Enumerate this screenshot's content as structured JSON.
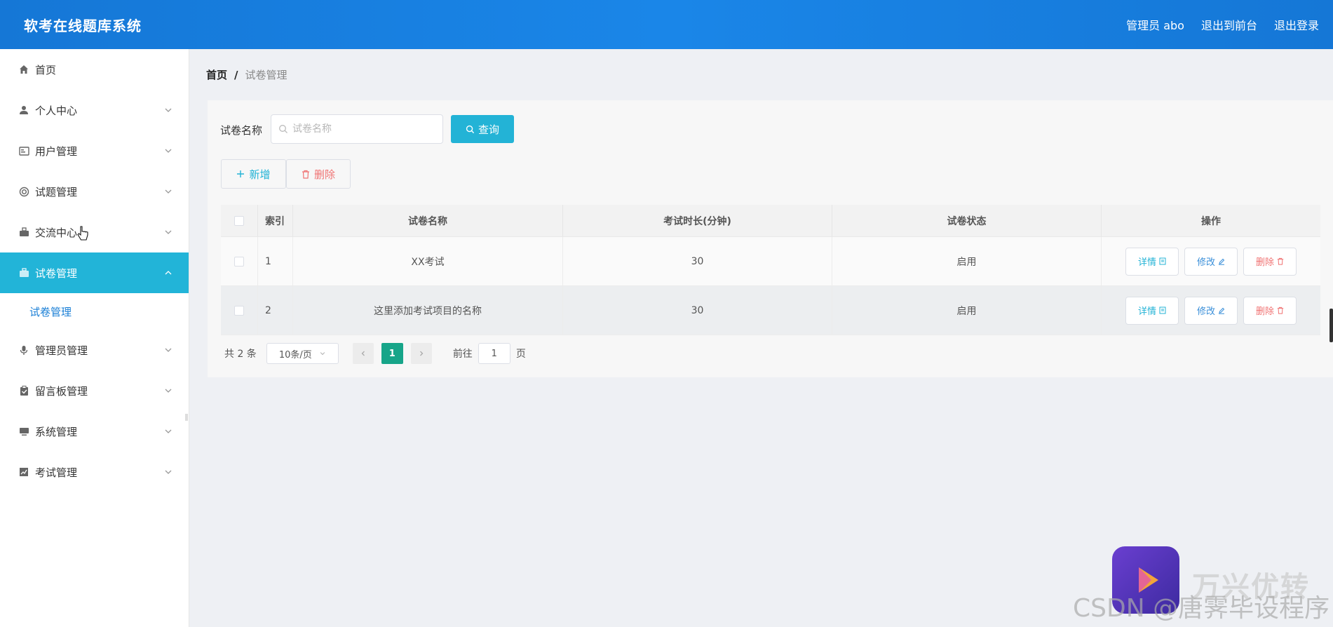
{
  "header": {
    "title": "软考在线题库系统",
    "admin": "管理员 abo",
    "front": "退出到前台",
    "logout": "退出登录"
  },
  "sidebar": {
    "items": [
      {
        "label": "首页",
        "icon": "home-icon"
      },
      {
        "label": "个人中心",
        "icon": "user-icon"
      },
      {
        "label": "用户管理",
        "icon": "id-card-icon"
      },
      {
        "label": "试题管理",
        "icon": "lifebuoy-icon"
      },
      {
        "label": "交流中心",
        "icon": "chat-icon"
      },
      {
        "label": "试卷管理",
        "icon": "briefcase-icon"
      },
      {
        "label": "管理员管理",
        "icon": "mic-icon"
      },
      {
        "label": "留言板管理",
        "icon": "clipboard-icon"
      },
      {
        "label": "系统管理",
        "icon": "monitor-icon"
      },
      {
        "label": "考试管理",
        "icon": "chart-icon"
      }
    ],
    "submenu": [
      "试卷管理"
    ]
  },
  "breadcrumb": {
    "home": "首页",
    "sep": "/",
    "current": "试卷管理"
  },
  "search": {
    "label": "试卷名称",
    "placeholder": "试卷名称",
    "query_button": "查询"
  },
  "toolbar": {
    "add": "新增",
    "delete": "删除"
  },
  "table": {
    "headers": [
      "索引",
      "试卷名称",
      "考试时长(分钟)",
      "试卷状态",
      "操作"
    ],
    "rows": [
      {
        "index": "1",
        "name": "XX考试",
        "duration": "30",
        "status": "启用"
      },
      {
        "index": "2",
        "name": "这里添加考试项目的名称",
        "duration": "30",
        "status": "启用"
      }
    ],
    "ops": {
      "detail": "详情",
      "edit": "修改",
      "delete": "删除"
    }
  },
  "pagination": {
    "total": "共 2 条",
    "page_size": "10条/页",
    "current_page": "1",
    "goto_prefix": "前往",
    "goto_value": "1",
    "goto_suffix": "页"
  },
  "watermark": {
    "brand": "万兴优转",
    "csdn": "CSDN @唐霁毕设程序"
  },
  "colors": {
    "header": "#1a86e8",
    "active_menu": "#22b4d8",
    "primary": "#23b3d6",
    "danger": "#f07272",
    "page_active": "#17a589"
  }
}
